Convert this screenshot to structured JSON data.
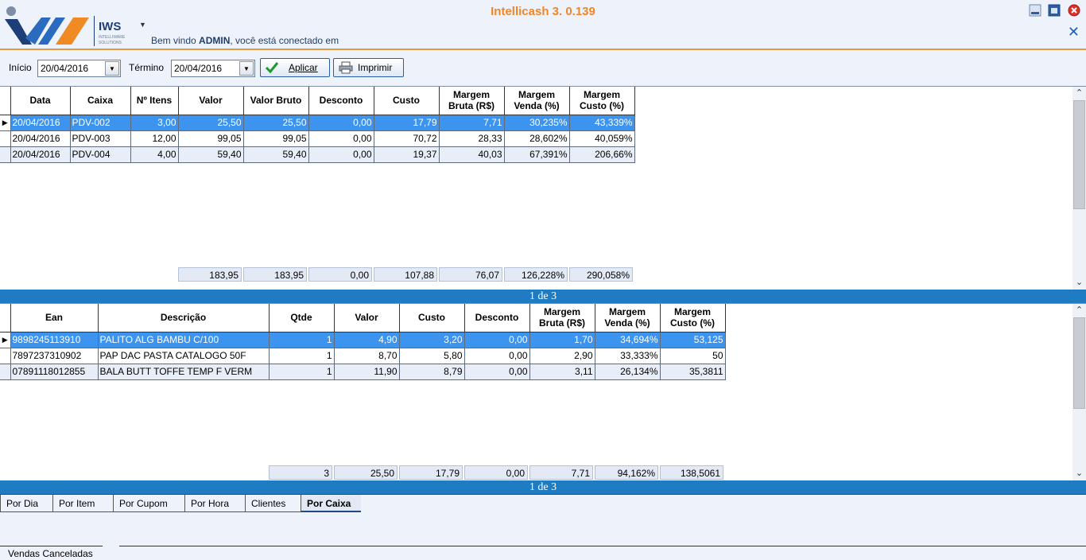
{
  "header": {
    "app_title": "Intellicash 3. 0.139",
    "logo_text": "IWS",
    "logo_subtext": "INTELLIWARE SOLUTIONS",
    "welcome_prefix": "Bem vindo ",
    "welcome_user": "ADMIN",
    "welcome_suffix": ", você está conectado em"
  },
  "toolbar": {
    "start_label": "Início",
    "start_value": "20/04/2016",
    "end_label": "Término",
    "end_value": "20/04/2016",
    "apply_label": "Aplicar",
    "print_label": "Imprimir"
  },
  "grid1": {
    "columns": [
      "Data",
      "Caixa",
      "Nº Itens",
      "Valor",
      "Valor Bruto",
      "Desconto",
      "Custo",
      "Margem Bruta (R$)",
      "Margem Venda (%)",
      "Margem Custo (%)"
    ],
    "rows": [
      [
        "20/04/2016",
        "PDV-002",
        "3,00",
        "25,50",
        "25,50",
        "0,00",
        "17,79",
        "7,71",
        "30,235%",
        "43,339%"
      ],
      [
        "20/04/2016",
        "PDV-003",
        "12,00",
        "99,05",
        "99,05",
        "0,00",
        "70,72",
        "28,33",
        "28,602%",
        "40,059%"
      ],
      [
        "20/04/2016",
        "PDV-004",
        "4,00",
        "59,40",
        "59,40",
        "0,00",
        "19,37",
        "40,03",
        "67,391%",
        "206,66%"
      ]
    ],
    "totals": [
      "183,95",
      "183,95",
      "0,00",
      "107,88",
      "76,07",
      "126,228%",
      "290,058%"
    ],
    "pager": "1 de 3"
  },
  "grid2": {
    "columns": [
      "Ean",
      "Descrição",
      "Qtde",
      "Valor",
      "Custo",
      "Desconto",
      "Margem Bruta (R$)",
      "Margem Venda (%)",
      "Margem Custo (%)"
    ],
    "rows": [
      [
        "9898245113910",
        "PALITO ALG BAMBU C/100",
        "1",
        "4,90",
        "3,20",
        "0,00",
        "1,70",
        "34,694%",
        "53,125"
      ],
      [
        "7897237310902",
        "PAP DAC PASTA CATALOGO 50F",
        "1",
        "8,70",
        "5,80",
        "0,00",
        "2,90",
        "33,333%",
        "50"
      ],
      [
        "07891118012855",
        "BALA BUTT TOFFE TEMP F VERM",
        "1",
        "11,90",
        "8,79",
        "0,00",
        "3,11",
        "26,134%",
        "35,3811"
      ]
    ],
    "totals": [
      "3",
      "25,50",
      "17,79",
      "0,00",
      "7,71",
      "94,162%",
      "138,5061"
    ],
    "pager": "1 de 3"
  },
  "tabs": [
    "Por Dia",
    "Por Item",
    "Por Cupom",
    "Por Hora",
    "Clientes",
    "Por Caixa"
  ],
  "active_tab": "Por Caixa",
  "bottom_tab": "Vendas Canceladas",
  "colors": {
    "accent_orange": "#f0862b",
    "selection_blue": "#3d94ee",
    "pager_blue": "#1f7bc2",
    "background": "#eef3fb"
  }
}
